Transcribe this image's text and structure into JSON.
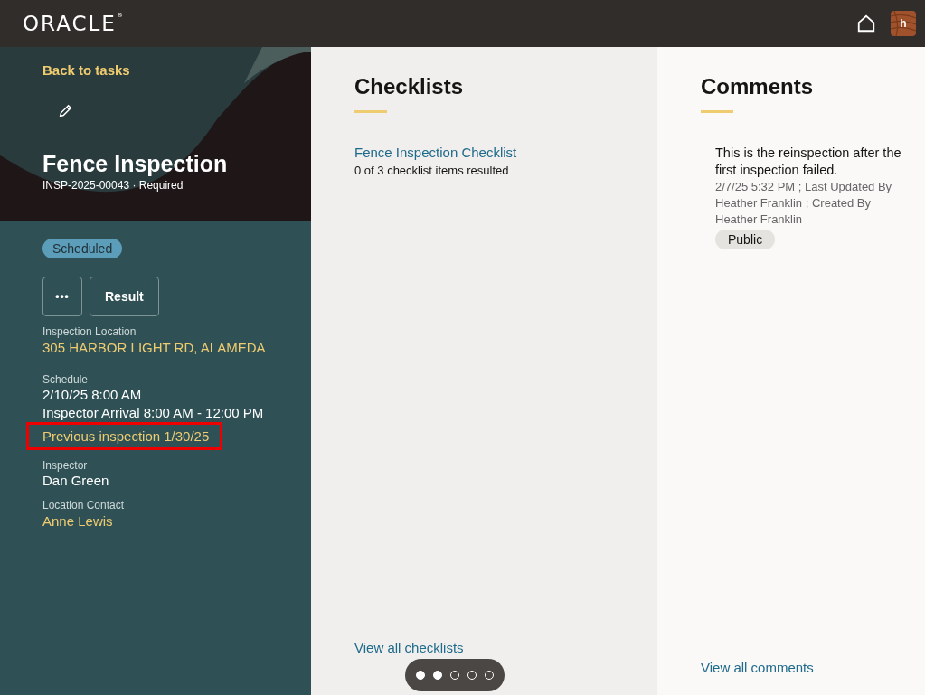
{
  "header": {
    "logo": "ORACLE",
    "logo_mark": "®",
    "avatar": "h"
  },
  "task": {
    "back_link": "Back to tasks",
    "title": "Fence Inspection",
    "subtitle": "INSP-2025-00043 · Required",
    "status": "Scheduled",
    "more_button": "•••",
    "result_button": "Result"
  },
  "details": [
    {
      "kind": "link",
      "label": "Inspection Location",
      "lines": [
        "305 HARBOR LIGHT RD, ALAMEDA"
      ]
    },
    {
      "kind": "text",
      "label": "Schedule",
      "lines": [
        "2/10/25 8:00 AM",
        "Inspector Arrival  8:00 AM - 12:00 PM"
      ]
    },
    {
      "kind": "highlight_link",
      "lines": [
        "Previous inspection 1/30/25"
      ]
    },
    {
      "kind": "text",
      "label": "Inspector",
      "lines": [
        "Dan Green"
      ]
    },
    {
      "kind": "link",
      "label": "Location Contact",
      "lines": [
        "Anne Lewis"
      ]
    }
  ],
  "checklists": {
    "title": "Checklists",
    "items": [
      {
        "name": "Fence Inspection Checklist",
        "summary": "0 of 3 checklist items resulted"
      }
    ],
    "footer_link": "View all checklists"
  },
  "comments": {
    "title": "Comments",
    "items": [
      {
        "text": "This is the reinspection after the first inspection failed.",
        "meta": "2/7/25 5:32 PM ;   Last Updated By Heather Franklin ;   Created By Heather Franklin",
        "tag": "Public"
      }
    ],
    "footer_link": "View all comments"
  },
  "pager": [
    {
      "selected": true
    },
    {
      "selected": true
    },
    {
      "selected": false
    },
    {
      "selected": false
    },
    {
      "selected": false
    }
  ]
}
